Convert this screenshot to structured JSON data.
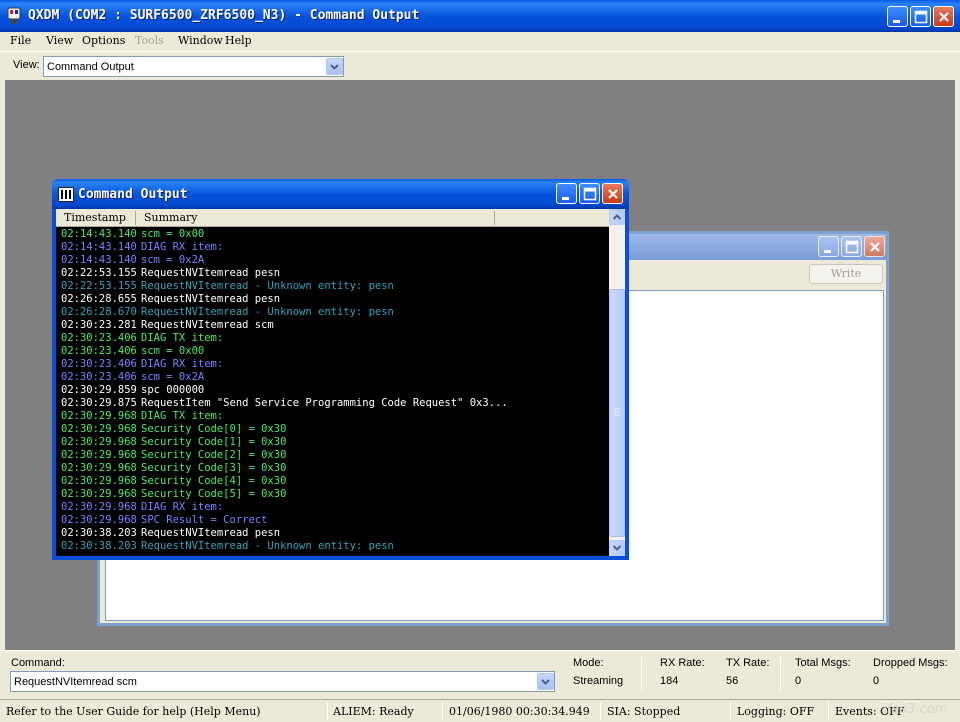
{
  "window": {
    "title": "QXDM (COM2 : SURF6500_ZRF6500_N3) - Command Output"
  },
  "menu": [
    {
      "label": "File",
      "enabled": true
    },
    {
      "label": "View",
      "enabled": true
    },
    {
      "label": "Options",
      "enabled": true
    },
    {
      "label": "Tools",
      "enabled": false
    },
    {
      "label": "Window",
      "enabled": true
    },
    {
      "label": "Help",
      "enabled": true
    }
  ],
  "view_selector": {
    "label": "View:",
    "value": "Command Output"
  },
  "nv_window": {
    "write_label": "Write"
  },
  "command_output": {
    "title": "Command Output",
    "columns": [
      "Timestamp",
      "Summary"
    ],
    "colors": {
      "green": "#4ce86a",
      "blue": "#7b82ff",
      "white": "#ffffff",
      "teal": "#3aa0b8"
    },
    "rows": [
      {
        "timestamp": "02:14:43.140",
        "summary": "scm = 0x00",
        "color": "green"
      },
      {
        "timestamp": "02:14:43.140",
        "summary": "DIAG RX item:",
        "color": "blue"
      },
      {
        "timestamp": "02:14:43.140",
        "summary": "scm = 0x2A",
        "color": "blue"
      },
      {
        "timestamp": "02:22:53.155",
        "summary": "RequestNVItemread pesn",
        "color": "white"
      },
      {
        "timestamp": "02:22:53.155",
        "summary": "RequestNVItemread - Unknown entity: pesn",
        "color": "teal"
      },
      {
        "timestamp": "02:26:28.655",
        "summary": "RequestNVItemread pesn",
        "color": "white"
      },
      {
        "timestamp": "02:26:28.670",
        "summary": "RequestNVItemread - Unknown entity: pesn",
        "color": "teal"
      },
      {
        "timestamp": "02:30:23.281",
        "summary": "RequestNVItemread scm",
        "color": "white"
      },
      {
        "timestamp": "02:30:23.406",
        "summary": "DIAG TX item:",
        "color": "green"
      },
      {
        "timestamp": "02:30:23.406",
        "summary": "scm = 0x00",
        "color": "green"
      },
      {
        "timestamp": "02:30:23.406",
        "summary": "DIAG RX item:",
        "color": "blue"
      },
      {
        "timestamp": "02:30:23.406",
        "summary": "scm = 0x2A",
        "color": "blue"
      },
      {
        "timestamp": "02:30:29.859",
        "summary": "spc 000000",
        "color": "white"
      },
      {
        "timestamp": "02:30:29.875",
        "summary": "RequestItem \"Send Service Programming Code Request\" 0x3...",
        "color": "white"
      },
      {
        "timestamp": "02:30:29.968",
        "summary": "DIAG TX item:",
        "color": "green"
      },
      {
        "timestamp": "02:30:29.968",
        "summary": "Security Code[0] = 0x30",
        "color": "green"
      },
      {
        "timestamp": "02:30:29.968",
        "summary": "Security Code[1] = 0x30",
        "color": "green"
      },
      {
        "timestamp": "02:30:29.968",
        "summary": "Security Code[2] = 0x30",
        "color": "green"
      },
      {
        "timestamp": "02:30:29.968",
        "summary": "Security Code[3] = 0x30",
        "color": "green"
      },
      {
        "timestamp": "02:30:29.968",
        "summary": "Security Code[4] = 0x30",
        "color": "green"
      },
      {
        "timestamp": "02:30:29.968",
        "summary": "Security Code[5] = 0x30",
        "color": "green"
      },
      {
        "timestamp": "02:30:29.968",
        "summary": "DIAG RX item:",
        "color": "blue"
      },
      {
        "timestamp": "02:30:29.968",
        "summary": "SPC Result = Correct",
        "color": "blue"
      },
      {
        "timestamp": "02:30:38.203",
        "summary": "RequestNVItemread pesn",
        "color": "white"
      },
      {
        "timestamp": "02:30:38.203",
        "summary": "RequestNVItemread - Unknown entity: pesn",
        "color": "teal"
      }
    ]
  },
  "command_bar": {
    "command_label": "Command:",
    "command_value": "RequestNVItemread scm",
    "mode_label": "Mode:",
    "mode_value": "Streaming",
    "rx_label": "RX Rate:",
    "rx_value": "184",
    "tx_label": "TX Rate:",
    "tx_value": "56",
    "total_label": "Total Msgs:",
    "total_value": "0",
    "dropped_label": "Dropped Msgs:",
    "dropped_value": "0"
  },
  "status_bar": {
    "help": "Refer to the User Guide for help (Help Menu)",
    "alien": "ALIEM: Ready",
    "datetime": "01/06/1980 00:30:34.949",
    "sia": "SIA: Stopped",
    "logging": "Logging: OFF",
    "events": "Events: OFF"
  },
  "watermark": "ifeo3.com"
}
